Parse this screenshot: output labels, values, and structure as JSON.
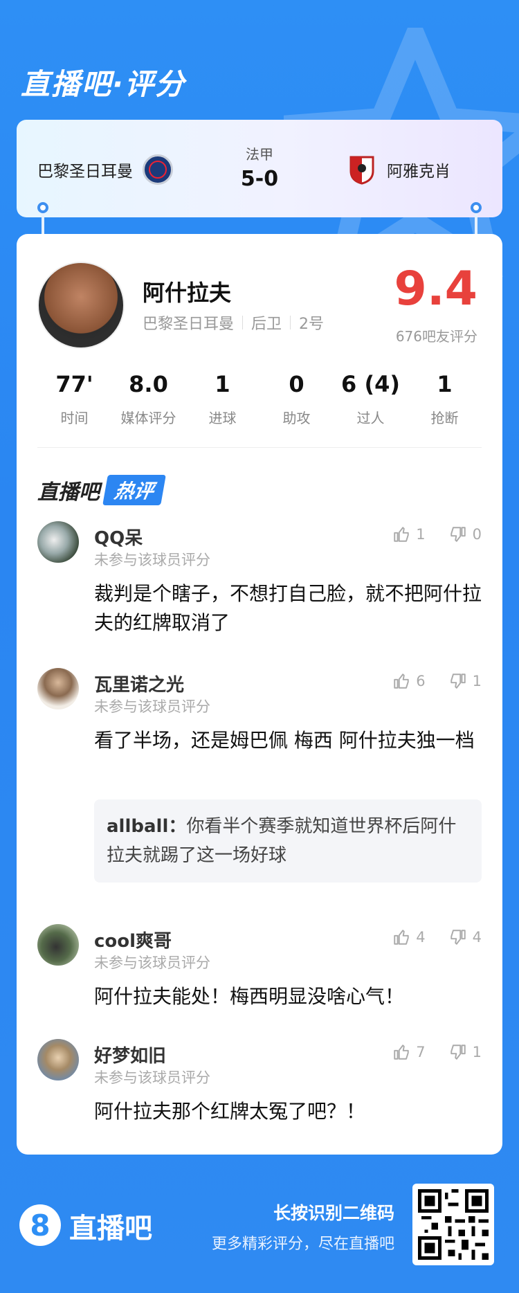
{
  "header": {
    "title": "直播吧·评分"
  },
  "match": {
    "league": "法甲",
    "score": "5-0",
    "home_team": "巴黎圣日耳曼",
    "away_team": "阿雅克肖"
  },
  "player": {
    "name": "阿什拉夫",
    "team": "巴黎圣日耳曼",
    "position": "后卫",
    "number": "2号",
    "rating": "9.4",
    "rating_count": "676吧友评分"
  },
  "stats": [
    {
      "value": "77'",
      "label": "时间"
    },
    {
      "value": "8.0",
      "label": "媒体评分"
    },
    {
      "value": "1",
      "label": "进球"
    },
    {
      "value": "0",
      "label": "助攻"
    },
    {
      "value": "6 (4)",
      "label": "过人"
    },
    {
      "value": "1",
      "label": "抢断"
    }
  ],
  "hot": {
    "part1": "直播吧",
    "part2": "热评"
  },
  "comments": [
    {
      "user": "QQ呆",
      "sub": "未参与该球员评分",
      "likes": "1",
      "dislikes": "0",
      "text": "裁判是个瞎子，不想打自己脸，就不把阿什拉夫的红牌取消了"
    },
    {
      "user": "瓦里诺之光",
      "sub": "未参与该球员评分",
      "likes": "6",
      "dislikes": "1",
      "text": "看了半场，还是姆巴佩 梅西 阿什拉夫独一档",
      "reply": {
        "user": "allball：",
        "text": "你看半个赛季就知道世界杯后阿什拉夫就踢了这一场好球"
      }
    },
    {
      "user": "cool爽哥",
      "sub": "未参与该球员评分",
      "likes": "4",
      "dislikes": "4",
      "text": "阿什拉夫能处！梅西明显没啥心气！"
    },
    {
      "user": "好梦如旧",
      "sub": "未参与该球员评分",
      "likes": "7",
      "dislikes": "1",
      "text": "阿什拉夫那个红牌太冤了吧？！"
    }
  ],
  "footer": {
    "logo_digit": "8",
    "logo_text": "直播吧",
    "line1": "长按识别二维码",
    "line2": "更多精彩评分，尽在直播吧"
  },
  "colors": {
    "accent": "#2e8ff5",
    "rating": "#e8413c"
  }
}
